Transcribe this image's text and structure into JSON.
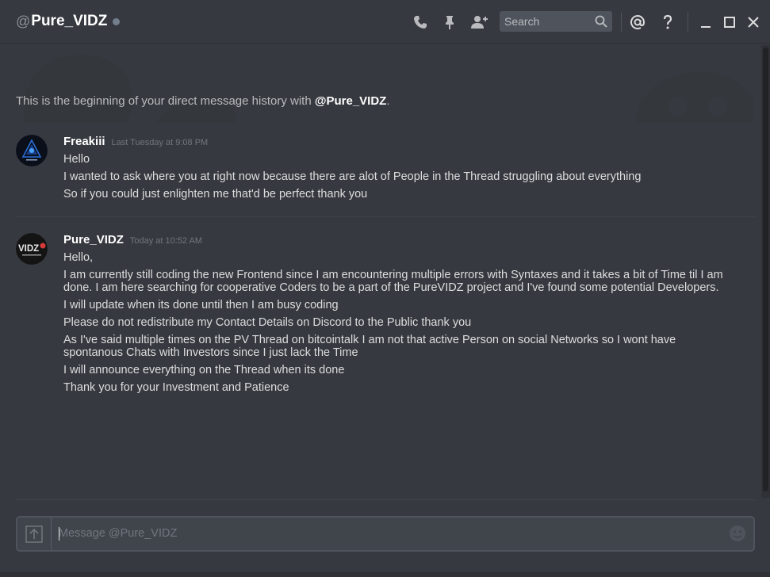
{
  "header": {
    "at_symbol": "@",
    "username": "Pure_VIDZ",
    "status": "offline",
    "icons": [
      "phone-icon",
      "pin-icon",
      "add-friend-icon",
      "mention-icon",
      "help-icon",
      "minimize-icon",
      "maximize-icon",
      "close-icon"
    ],
    "search_placeholder": "Search"
  },
  "intro": {
    "prefix": "This is the beginning of your direct message history with",
    "handle": "@Pure_VIDZ",
    "suffix": "."
  },
  "messages": [
    {
      "author": "Freakiii",
      "timestamp": "Last Tuesday at 9:08 PM",
      "avatar_text": "",
      "lines": [
        "Hello",
        "I wanted to ask where you at right now because there are alot of People in the Thread struggling about everything",
        "So if you could just enlighten me that'd be perfect thank you"
      ]
    },
    {
      "author": "Pure_VIDZ",
      "timestamp": "Today at 10:52 AM",
      "avatar_text": "VIDZ",
      "lines": [
        "Hello,",
        "I am currently still coding the new Frontend since I am encountering multiple errors with Syntaxes and it takes a bit of Time til I am done. I am here searching for cooperative Coders to be a part of the PureVIDZ project and I've found some potential Developers.",
        "I will update when its done until then I am busy coding",
        "Please do not redistribute my Contact Details on Discord to the Public thank you",
        "As I've said multiple times on the PV Thread on bitcointalk I am not that active Person on social Networks so I wont have spontanous Chats with Investors since I just lack the Time",
        "I will announce everything on the Thread when its done",
        "Thank you for your Investment and Patience"
      ]
    }
  ],
  "composer": {
    "placeholder": "Message @Pure_VIDZ",
    "value": ""
  },
  "colors": {
    "background": "#36393f",
    "text": "#dcddde",
    "muted": "#72767d",
    "input": "#40444b"
  }
}
